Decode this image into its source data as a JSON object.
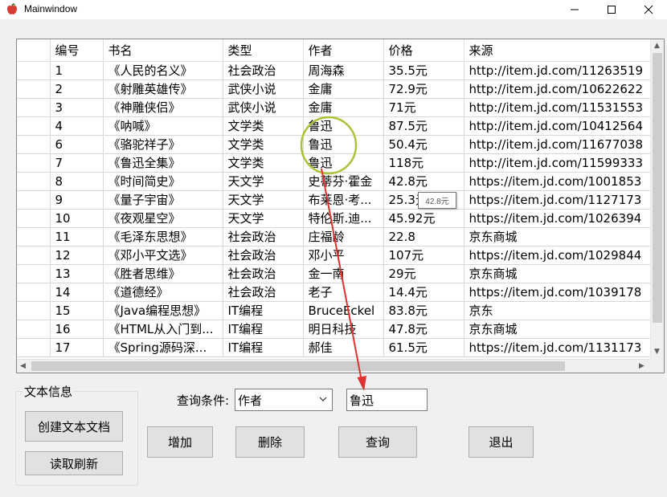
{
  "window": {
    "title": "Mainwindow",
    "app_icon": "apple-icon",
    "controls": [
      "minimize-icon",
      "maximize-icon",
      "close-icon"
    ]
  },
  "table": {
    "columns": [
      "编号",
      "书名",
      "类型",
      "作者",
      "价格",
      "来源"
    ],
    "rows": [
      [
        "1",
        "《人民的名义》",
        "社会政治",
        "周海森",
        "35.5元",
        "http://item.jd.com/11263519"
      ],
      [
        "2",
        "《射雕英雄传》",
        "武侠小说",
        "金庸",
        "72.9元",
        "http://item.jd.com/10622622"
      ],
      [
        "3",
        "《神雕侠侣》",
        "武侠小说",
        "金庸",
        "71元",
        "http://item.jd.com/11531553"
      ],
      [
        "4",
        "《呐喊》",
        "文学类",
        "鲁迅",
        "87.5元",
        "http://item.jd.com/10412564"
      ],
      [
        "6",
        "《骆驼祥子》",
        "文学类",
        "鲁迅",
        "50.4元",
        "http://item.jd.com/11677038"
      ],
      [
        "7",
        "《鲁迅全集》",
        "文学类",
        "鲁迅",
        "118元",
        "http://item.jd.com/11599333"
      ],
      [
        "8",
        "《时间简史》",
        "天文学",
        "史蒂芬·霍金",
        "42.8元",
        "https://item.jd.com/1001853"
      ],
      [
        "9",
        "《量子宇宙》",
        "天文学",
        "布莱恩·考...",
        "25.3元",
        "https://item.jd.com/1127173"
      ],
      [
        "10",
        "《夜观星空》",
        "天文学",
        "特伦斯.迪...",
        "45.92元",
        "https://item.jd.com/1026394"
      ],
      [
        "11",
        "《毛泽东思想》",
        "社会政治",
        "庄福龄",
        "22.8",
        "京东商城"
      ],
      [
        "12",
        "《邓小平文选》",
        "社会政治",
        "邓小平",
        "107元",
        "https://item.jd.com/1029844"
      ],
      [
        "13",
        "《胜者思维》",
        "社会政治",
        "金一南",
        "29元",
        "京东商城"
      ],
      [
        "14",
        "《道德经》",
        "社会政治",
        "老子",
        "14.4元",
        "https://item.jd.com/1039178"
      ],
      [
        "15",
        "《Java编程思想》",
        "IT编程",
        "BruceEckel",
        "83.8元",
        "京东"
      ],
      [
        "16",
        "《HTML从入门到...",
        "IT编程",
        "明日科技",
        "47.8元",
        "京东商城"
      ],
      [
        "17",
        "《Spring源码深...",
        "IT编程",
        "郝佳",
        "61.5元",
        "https://item.jd.com/1131173"
      ]
    ],
    "tooltip": "42.8元"
  },
  "group": {
    "title": "文本信息",
    "create_label": "创建文本文档",
    "refresh_label": "读取刷新"
  },
  "query": {
    "condition_label": "查询条件:",
    "condition_value": "作者",
    "text_value": "鲁迅"
  },
  "buttons": {
    "add": "增加",
    "delete": "删除",
    "search": "查询",
    "exit": "退出"
  },
  "colors": {
    "annotation_circle": "#a8c43a",
    "annotation_arrow": "#e03030"
  }
}
